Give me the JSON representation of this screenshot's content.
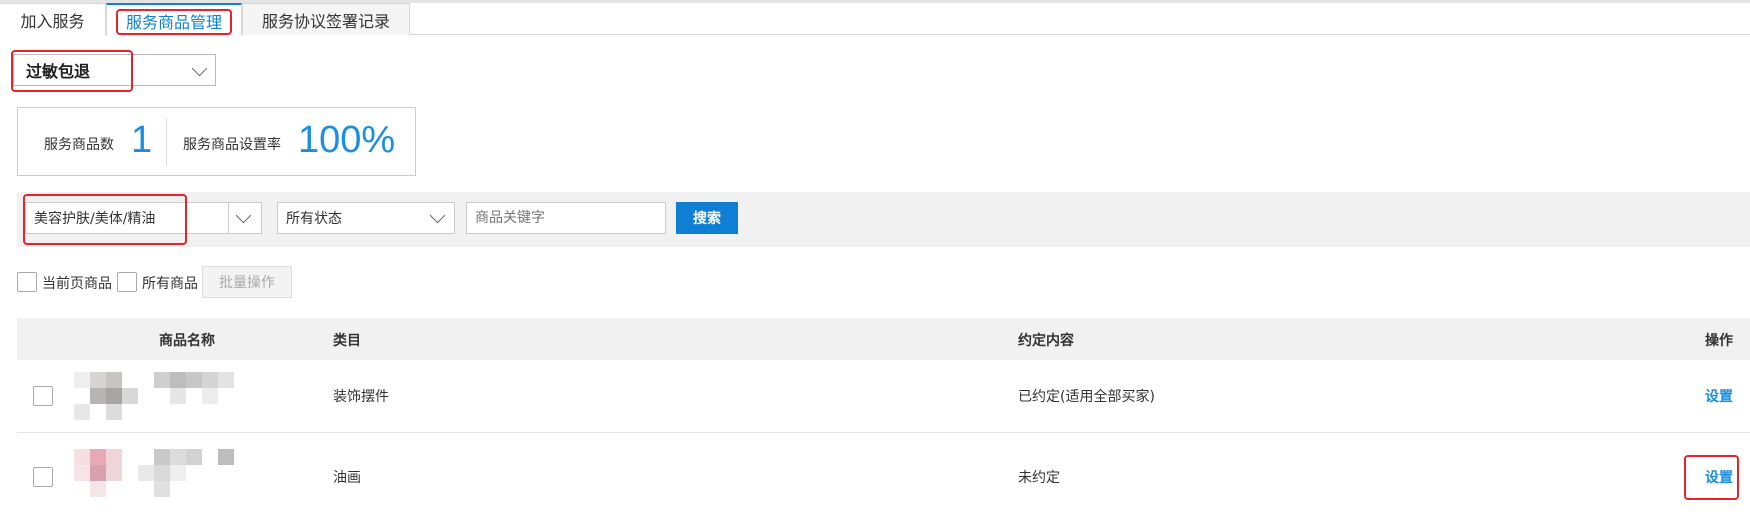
{
  "tabs": [
    {
      "label": "加入服务"
    },
    {
      "label": "服务商品管理"
    },
    {
      "label": "服务协议签署记录"
    }
  ],
  "service_select": {
    "value": "过敏包退"
  },
  "stats": {
    "count_label": "服务商品数",
    "count_value": "1",
    "rate_label": "服务商品设置率",
    "rate_value": "100%"
  },
  "filters": {
    "category_value": "美容护肤/美体/精油",
    "status_value": "所有状态",
    "keyword_placeholder": "商品关键字",
    "search_label": "搜索"
  },
  "batch": {
    "current_page_label": "当前页商品",
    "all_label": "所有商品",
    "batch_button_label": "批量操作"
  },
  "table": {
    "headers": {
      "name": "商品名称",
      "category": "类目",
      "agreement": "约定内容",
      "action": "操作"
    },
    "rows": [
      {
        "category": "装饰摆件",
        "agreement": "已约定(适用全部买家)",
        "action": "设置"
      },
      {
        "category": "油画",
        "agreement": "未约定",
        "action": "设置"
      }
    ]
  },
  "colors": {
    "accent": "#0f82d8",
    "highlight_box": "#e8232b"
  }
}
